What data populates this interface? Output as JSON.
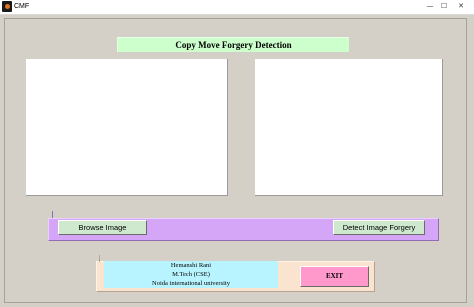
{
  "window": {
    "title": "CMF",
    "minimize_glyph": "—",
    "maximize_glyph": "☐",
    "close_glyph": "✕"
  },
  "heading": "Copy Move Forgery Detection",
  "buttons": {
    "browse": "Browse Image",
    "detect": "Detect Image Forgery",
    "exit": "EXIT"
  },
  "credits": {
    "name": "Hemanshi Rani",
    "degree": "M.Tech (CSE)",
    "university": "Noida international university"
  },
  "colors": {
    "window_background": "#d4d0c8",
    "heading_background": "#ccffcc",
    "button_strip": "#d5a6f8",
    "button_face": "#cfe9cf",
    "footer_panel": "#fbe4cf",
    "credits_background": "#b8f4ff",
    "exit_button": "#ff99cc"
  },
  "icons": [
    "app-icon",
    "minimize-icon",
    "maximize-icon",
    "close-icon"
  ]
}
